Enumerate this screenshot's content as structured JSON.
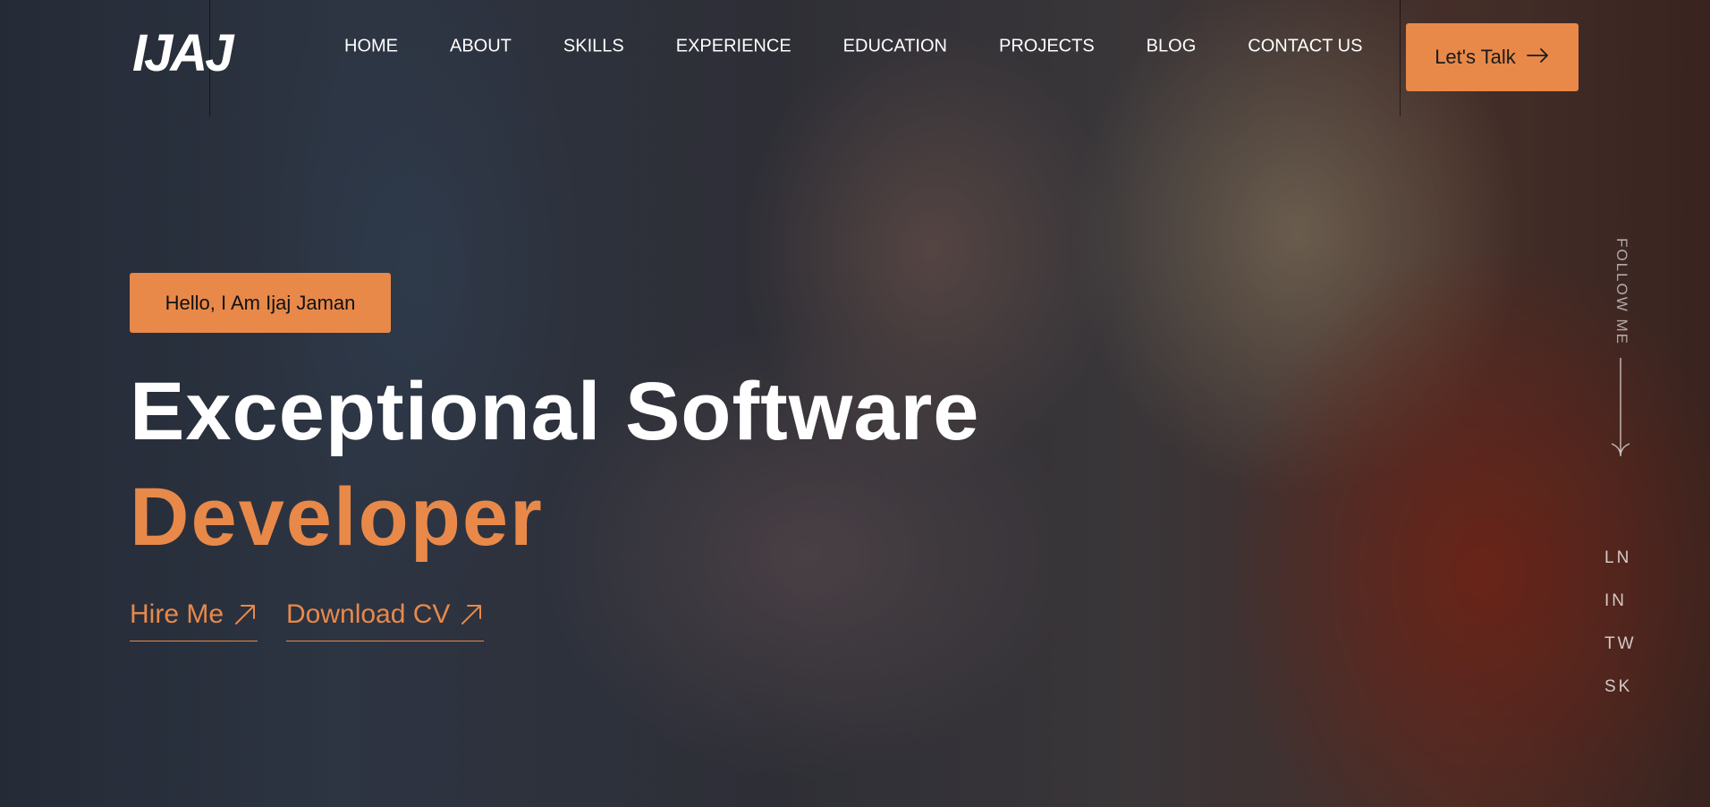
{
  "logo": {
    "text": "IJAJ"
  },
  "nav": {
    "items": [
      {
        "label": "HOME"
      },
      {
        "label": "ABOUT"
      },
      {
        "label": "SKILLS"
      },
      {
        "label": "EXPERIENCE"
      },
      {
        "label": "EDUCATION"
      },
      {
        "label": "PROJECTS"
      },
      {
        "label": "BLOG"
      },
      {
        "label": "CONTACT US"
      }
    ]
  },
  "header": {
    "cta_label": "Let's Talk",
    "cta_icon": "arrow-right-icon"
  },
  "hero": {
    "greeting": "Hello, I Am Ijaj Jaman",
    "headline_line1": "Exceptional Software",
    "headline_line2": "Developer",
    "hire_label": "Hire Me",
    "cv_label": "Download CV",
    "link_icon": "arrow-up-right-icon"
  },
  "follow": {
    "label": "FOLLOW ME",
    "icon": "arrow-down-icon",
    "socials": [
      {
        "label": "LN"
      },
      {
        "label": "IN"
      },
      {
        "label": "TW"
      },
      {
        "label": "SK"
      }
    ]
  },
  "colors": {
    "accent": "#e8894a",
    "text": "#ffffff"
  }
}
